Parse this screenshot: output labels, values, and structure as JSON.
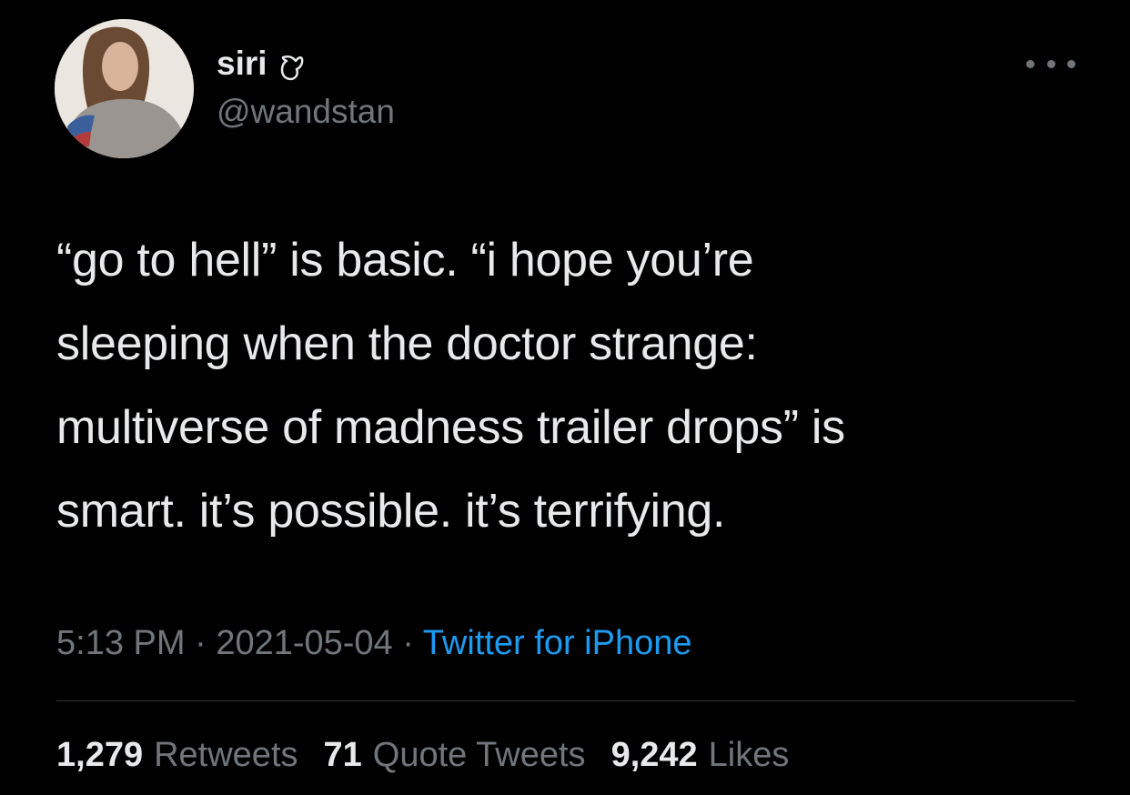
{
  "profile": {
    "display_name": "siri",
    "name_emoji": "moon-emoji",
    "handle": "@wandstan",
    "avatar": "user-avatar"
  },
  "tweet": {
    "lines": [
      "“go to hell” is basic. “i hope you’re",
      "sleeping when the doctor strange:",
      "multiverse of madness trailer drops” is",
      "smart. it’s possible. it’s terrifying."
    ]
  },
  "meta": {
    "time": "5:13 PM",
    "separator1": " · ",
    "date": "2021-05-04",
    "separator2": " · ",
    "source": "Twitter for iPhone"
  },
  "stats": {
    "retweets_count": "1,279",
    "retweets_label": "Retweets",
    "quotes_count": "71",
    "quotes_label": "Quote Tweets",
    "likes_count": "9,242",
    "likes_label": "Likes"
  },
  "colors": {
    "background": "#000000",
    "primary_text": "#e7e9ea",
    "secondary_text": "#71767b",
    "link": "#1d9bf0",
    "divider": "#2f3336"
  },
  "icons": {
    "more": "more-options-icon"
  }
}
